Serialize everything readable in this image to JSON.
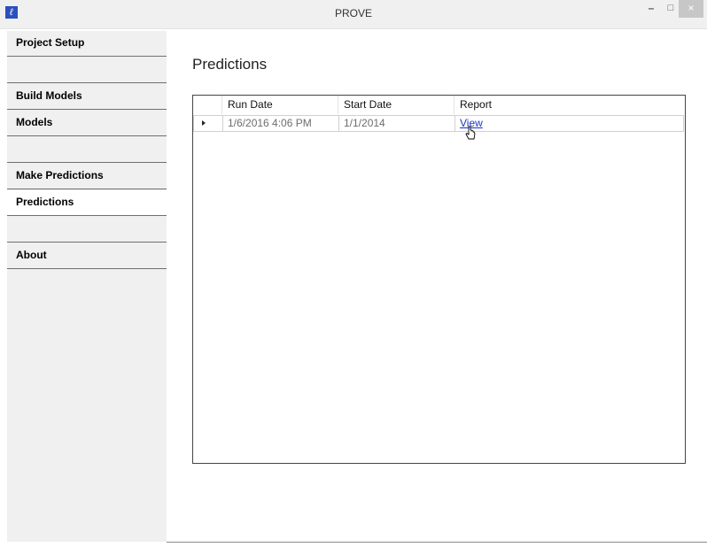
{
  "window": {
    "title": "PROVE",
    "app_icon": "app-logo-icon",
    "minimize_glyph": "–",
    "maximize_glyph": "□",
    "close_glyph": "×"
  },
  "sidebar": {
    "items": [
      {
        "label": "Project Setup",
        "active": false
      },
      {
        "label": "Build Models",
        "active": false
      },
      {
        "label": "Models",
        "active": false
      },
      {
        "label": "Make Predictions",
        "active": false
      },
      {
        "label": "Predictions",
        "active": true
      },
      {
        "label": "About",
        "active": false
      }
    ]
  },
  "main": {
    "title": "Predictions",
    "grid": {
      "columns": [
        "Run Date",
        "Start Date",
        "Report"
      ],
      "rows": [
        {
          "run_date": "1/6/2016 4:06 PM",
          "start_date": "1/1/2014",
          "report": "View"
        }
      ]
    }
  },
  "colors": {
    "sidebar_bg": "#f0f0f0",
    "link": "#1a33c9",
    "active_nav_bg": "#ffffff"
  }
}
